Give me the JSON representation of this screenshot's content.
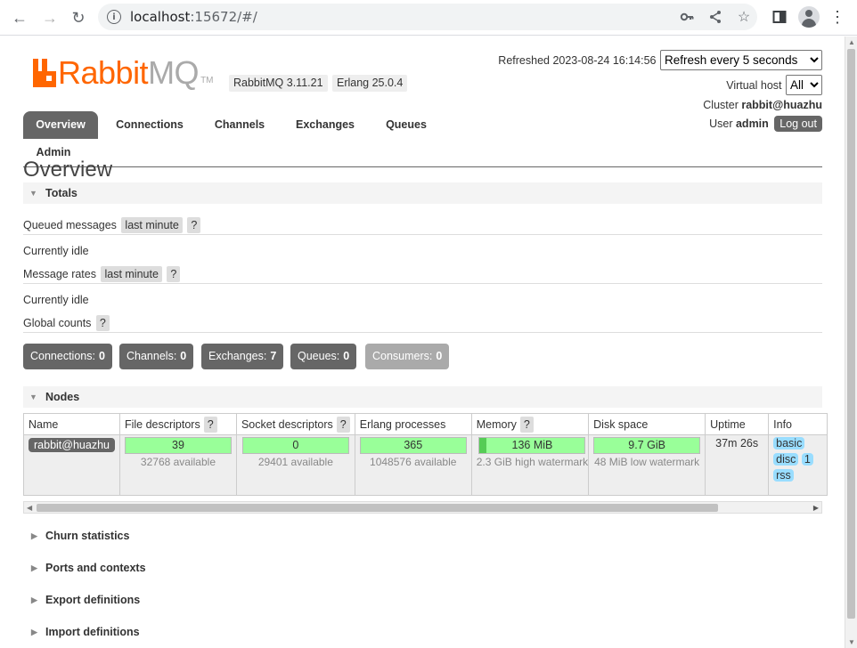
{
  "browser": {
    "url_host": "localhost",
    "url_rest": ":15672/#/"
  },
  "header": {
    "logo_rabbit": "Rabbit",
    "logo_mq": "MQ",
    "logo_tm": "TM",
    "rabbitmq_version": "RabbitMQ 3.11.21",
    "erlang_version": "Erlang 25.0.4",
    "refreshed_label": "Refreshed 2023-08-24 16:14:56",
    "refresh_select": "Refresh every 5 seconds",
    "virtual_host_label": "Virtual host",
    "virtual_host_select": "All",
    "cluster_label": "Cluster",
    "cluster_value": "rabbit@huazhu",
    "user_label": "User",
    "user_value": "admin",
    "logout_label": "Log out"
  },
  "tabs": [
    "Overview",
    "Connections",
    "Channels",
    "Exchanges",
    "Queues",
    "Admin"
  ],
  "page_title": "Overview",
  "totals": {
    "section_title": "Totals",
    "queued_messages_label": "Queued messages",
    "queued_messages_range": "last minute",
    "help": "?",
    "idle_1": "Currently idle",
    "message_rates_label": "Message rates",
    "message_rates_range": "last minute",
    "idle_2": "Currently idle",
    "global_counts_label": "Global counts",
    "counters": [
      {
        "label": "Connections:",
        "value": "0"
      },
      {
        "label": "Channels:",
        "value": "0"
      },
      {
        "label": "Exchanges:",
        "value": "7"
      },
      {
        "label": "Queues:",
        "value": "0"
      },
      {
        "label": "Consumers:",
        "value": "0"
      }
    ]
  },
  "nodes": {
    "section_title": "Nodes",
    "columns": [
      "Name",
      "File descriptors",
      "Socket descriptors",
      "Erlang processes",
      "Memory",
      "Disk space",
      "Uptime",
      "Info"
    ],
    "row": {
      "name": "rabbit@huazhu",
      "fd_used": "39",
      "fd_available": "32768 available",
      "sockets_used": "0",
      "sockets_available": "29401 available",
      "procs_used": "365",
      "procs_available": "1048576 available",
      "memory_used": "136 MiB",
      "memory_watermark": "2.3 GiB high watermark",
      "memory_fraction": 0.06,
      "disk_free": "9.7 GiB",
      "disk_watermark": "48 MiB low watermark",
      "uptime": "37m 26s",
      "info_tags": [
        "basic",
        "disc",
        "1",
        "rss"
      ]
    }
  },
  "collapsed_sections": [
    "Churn statistics",
    "Ports and contexts",
    "Export definitions",
    "Import definitions"
  ]
}
